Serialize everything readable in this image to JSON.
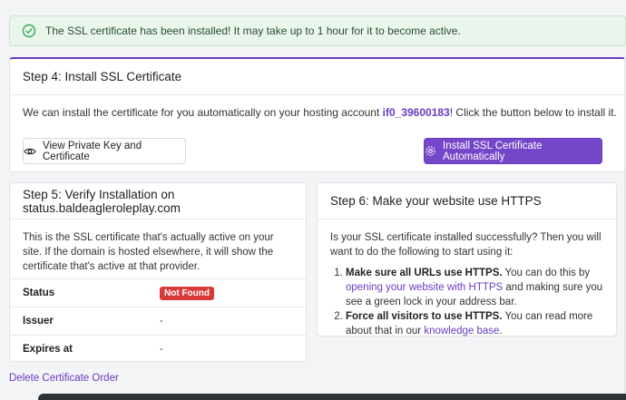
{
  "alert": {
    "icon": "check-circle-icon",
    "text": "The SSL certificate has been installed! It may take up to 1 hour for it to become active."
  },
  "step4": {
    "title": "Step 4: Install SSL Certificate",
    "desc_prefix": "We can install the certificate for you automatically on your hosting account ",
    "account": "if0_39600183",
    "desc_suffix": "! Click the button below to install it.",
    "view_button": "View Private Key and Certificate",
    "install_button": "Install SSL Certificate Automatically"
  },
  "step5": {
    "title": "Step 5: Verify Installation on status.baldeagleroleplay.com",
    "para": "This is the SSL certificate that's actually active on your site. If the domain is hosted elsewhere, it will show the certificate that's active at that provider.",
    "rows": [
      {
        "label": "Status",
        "value": "Not Found"
      },
      {
        "label": "Issuer",
        "value": "-"
      },
      {
        "label": "Expires at",
        "value": "-"
      }
    ]
  },
  "step6": {
    "title": "Step 6: Make your website use HTTPS",
    "para": "Is your SSL certificate installed successfully? Then you will want to do the following to start using it:",
    "item1_bold": "Make sure all URLs use HTTPS.",
    "item1_text_a": " You can do this by ",
    "item1_link": "opening your website with HTTPS",
    "item1_text_b": " and making sure you see a green lock in your address bar.",
    "item2_bold": "Force all visitors to use HTTPS.",
    "item2_text_a": " You can read more about that in our ",
    "item2_link": "knowledge base",
    "item2_text_b": "."
  },
  "footer": {
    "delete_link": "Delete Certificate Order"
  },
  "colors": {
    "accent": "#7446c9",
    "success_bg": "#eaf6ec",
    "danger": "#d83a3a"
  }
}
